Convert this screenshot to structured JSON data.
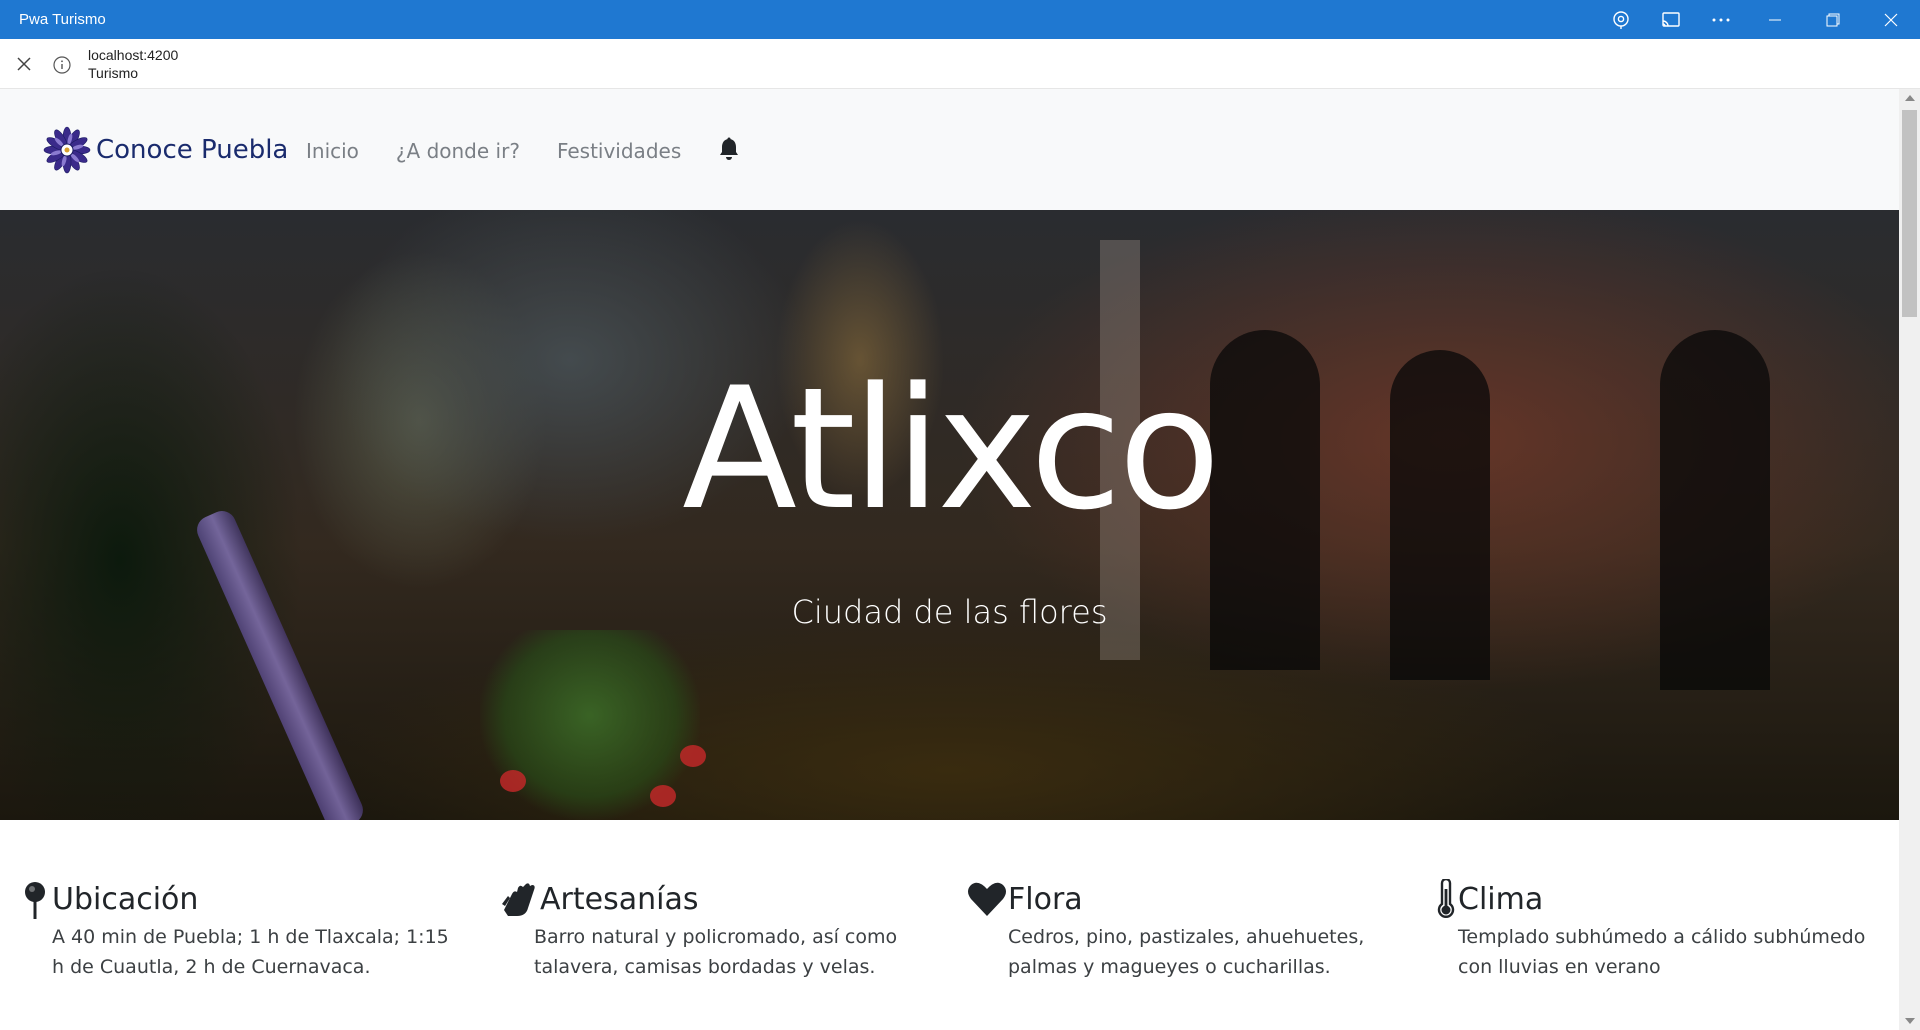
{
  "window": {
    "title": "Pwa Turismo",
    "icons": [
      "location-icon",
      "cast-icon",
      "more-icon",
      "minimize-icon",
      "restore-icon",
      "close-icon"
    ]
  },
  "address": {
    "url": "localhost:4200",
    "page_title": "Turismo"
  },
  "navbar": {
    "brand": "Conoce Puebla",
    "links": [
      "Inicio",
      "¿A donde ir?",
      "Festividades"
    ],
    "brand_color": "#1a2b6d"
  },
  "hero": {
    "title": "Atlixco",
    "subtitle": "Ciudad de las flores"
  },
  "info": [
    {
      "title": "Ubicación",
      "icon": "map-pin-icon",
      "text": "A 40 min de Puebla; 1 h de Tlaxcala; 1:15 h de Cuautla, 2 h de Cuernavaca."
    },
    {
      "title": "Artesanías",
      "icon": "hands-icon",
      "text": "Barro natural y policromado, así como talavera, camisas bordadas y velas."
    },
    {
      "title": "Flora",
      "icon": "heart-icon",
      "text": "Cedros, pino, pastizales, ahuehuetes, palmas y magueyes o cucharillas."
    },
    {
      "title": "Clima",
      "icon": "thermometer-icon",
      "text": "Templado subhúmedo a cálido subhúmedo con lluvias en verano"
    }
  ],
  "colors": {
    "titlebar": "#1f78d1",
    "navbar_bg": "#f8f9fa"
  }
}
